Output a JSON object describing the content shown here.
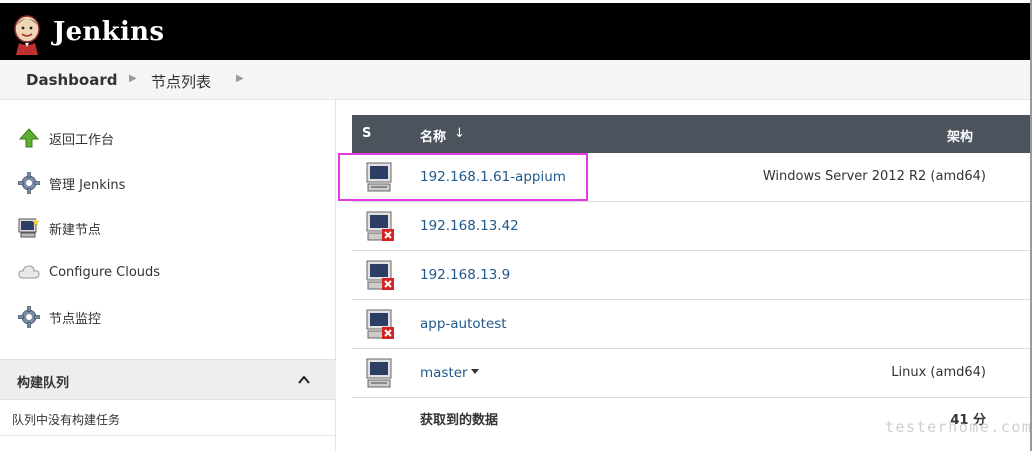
{
  "header": {
    "brand": "Jenkins",
    "logo_icon": "jenkins-butler-logo"
  },
  "breadcrumb": {
    "items": [
      "Dashboard",
      "节点列表"
    ]
  },
  "sidebar": {
    "tasks": [
      {
        "label": "返回工作台",
        "icon": "up-arrow-icon"
      },
      {
        "label": "管理 Jenkins",
        "icon": "gear-icon"
      },
      {
        "label": "新建节点",
        "icon": "new-computer-icon"
      },
      {
        "label": "Configure Clouds",
        "icon": "cloud-icon"
      },
      {
        "label": "节点监控",
        "icon": "gear-icon"
      }
    ],
    "queue": {
      "title": "构建队列",
      "empty": "队列中没有构建任务"
    }
  },
  "table": {
    "headers": {
      "s": "S",
      "name": "名称",
      "sort": "↓",
      "arch": "架构"
    },
    "rows": [
      {
        "name": "192.168.1.61-appium",
        "arch": "Windows Server 2012 R2 (amd64)",
        "status": "online"
      },
      {
        "name": "192.168.13.42",
        "arch": "",
        "status": "offline"
      },
      {
        "name": "192.168.13.9",
        "arch": "",
        "status": "offline"
      },
      {
        "name": "app-autotest",
        "arch": "",
        "status": "offline"
      },
      {
        "name": "master",
        "arch": "Linux (amd64)",
        "status": "online"
      }
    ],
    "summary": {
      "label": "获取到的数据",
      "value": "41 分"
    }
  },
  "watermark": "testerhome.com",
  "colors": {
    "header_bg": "#000000",
    "table_head": "#4b545c",
    "link": "#20598b",
    "highlight": "#e33be3"
  }
}
